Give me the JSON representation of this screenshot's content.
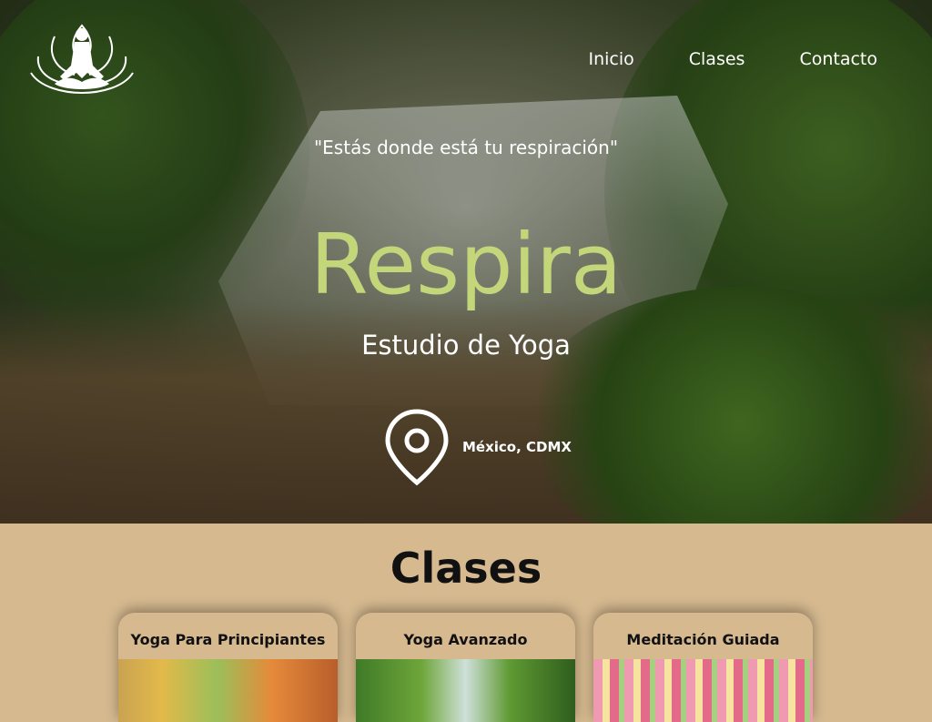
{
  "header": {
    "logo_icon": "meditating-lotus-icon",
    "nav": [
      {
        "label": "Inicio"
      },
      {
        "label": "Clases"
      },
      {
        "label": "Contacto"
      }
    ]
  },
  "hero": {
    "quote": "\"Estás donde está tu respiración\"",
    "title": "Respira",
    "subtitle": "Estudio de Yoga",
    "location_icon": "map-pin-icon",
    "location": "México, CDMX"
  },
  "classes": {
    "heading": "Clases",
    "cards": [
      {
        "title": "Yoga Para Principiantes"
      },
      {
        "title": "Yoga Avanzado"
      },
      {
        "title": "Meditación Guiada"
      }
    ]
  },
  "colors": {
    "accent": "#c3d67a",
    "section_bg": "#d6b98f",
    "text_dark": "#111111",
    "text_light": "#ffffff"
  }
}
